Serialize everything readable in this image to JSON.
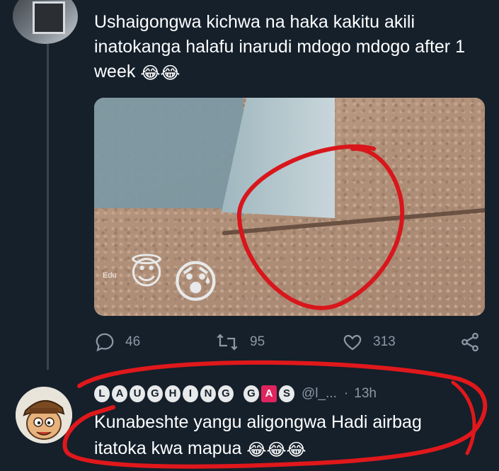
{
  "tweet": {
    "text": "Ushaigongwa kichwa na haka kakitu akili inatokanga halafu inarudi mdogo mdogo after 1 week",
    "emojis": "😂😂",
    "media": {
      "watermark": "Edu",
      "emoji_left": "😇",
      "emoji_right": "😰"
    },
    "actions": {
      "replies": "46",
      "retweets": "95",
      "likes": "313"
    }
  },
  "reply": {
    "display_name_letters": [
      "L",
      "A",
      "U",
      "G",
      "H",
      "I",
      "N",
      "G",
      "",
      "G",
      "A",
      "S"
    ],
    "handle": "@l_...",
    "separator": "·",
    "time": "13h",
    "text": "Kunabeshte yangu aligongwa Hadi airbag itatoka kwa mapua",
    "emojis": "😂😂😂"
  },
  "colors": {
    "background": "#15202b",
    "text": "#ffffff",
    "muted": "#8b98a5",
    "annotation_red": "#e0181b"
  },
  "icons": {
    "reply": "speech-bubble-icon",
    "retweet": "retweet-icon",
    "like": "heart-icon",
    "share": "share-icon"
  }
}
